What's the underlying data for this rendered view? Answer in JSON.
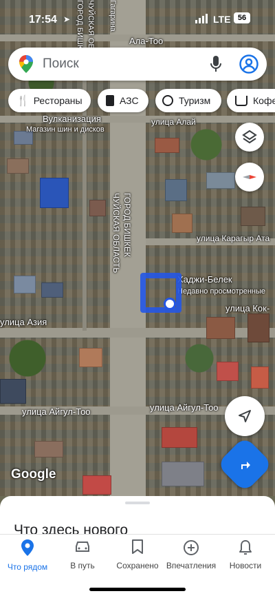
{
  "status_bar": {
    "time": "17:54",
    "carrier": "LTE",
    "battery": "56"
  },
  "search": {
    "placeholder": "Поиск"
  },
  "chips": [
    {
      "label": "Рестораны",
      "icon": "fork-knife-icon"
    },
    {
      "label": "АЗС",
      "icon": "fuel-icon"
    },
    {
      "label": "Туризм",
      "icon": "camera-icon"
    },
    {
      "label": "Кофе",
      "icon": "coffee-icon"
    }
  ],
  "map_labels": {
    "ala_too": "Ала-Тоо",
    "vulkanizatsiya": "Вулканизация",
    "magazin": "Магазин шин и дисков",
    "alai": "улица Алай",
    "gorod_bishkek_top": "ГОРОД БИШКЕК",
    "chuiskaya_top": "ЧУЙСКАЯ ОБЛАСТЬ",
    "gagarina": "Гагарина",
    "gorod_bishkek_mid": "ГОРОД БИШКЕК",
    "chuiskaya_mid": "ЧУЙСКАЯ ОБЛАСТЬ",
    "karagyr": "улица Карагыр Ата",
    "khadzhi_belek": "Хаджи-Белек",
    "recently_viewed": "Недавно просмотренные",
    "kok_dzhar": "улица Кок-",
    "aziya": "улица Азия",
    "aigul_too_left": "улица Айгул-Тоо",
    "aigul_too_right": "улица Айгул-Тоо",
    "google": "Google"
  },
  "sheet": {
    "title": "Что здесь нового"
  },
  "nav": [
    {
      "label": "Что рядом",
      "icon": "location-pin-icon",
      "active": true
    },
    {
      "label": "В путь",
      "icon": "car-icon",
      "active": false
    },
    {
      "label": "Сохранено",
      "icon": "bookmark-icon",
      "active": false
    },
    {
      "label": "Впечатления",
      "icon": "add-circle-icon",
      "active": false
    },
    {
      "label": "Новости",
      "icon": "bell-icon",
      "active": false
    }
  ],
  "colors": {
    "accent": "#1a73e8",
    "nav_active": "#1a73e8",
    "marker": "#2456e6"
  }
}
